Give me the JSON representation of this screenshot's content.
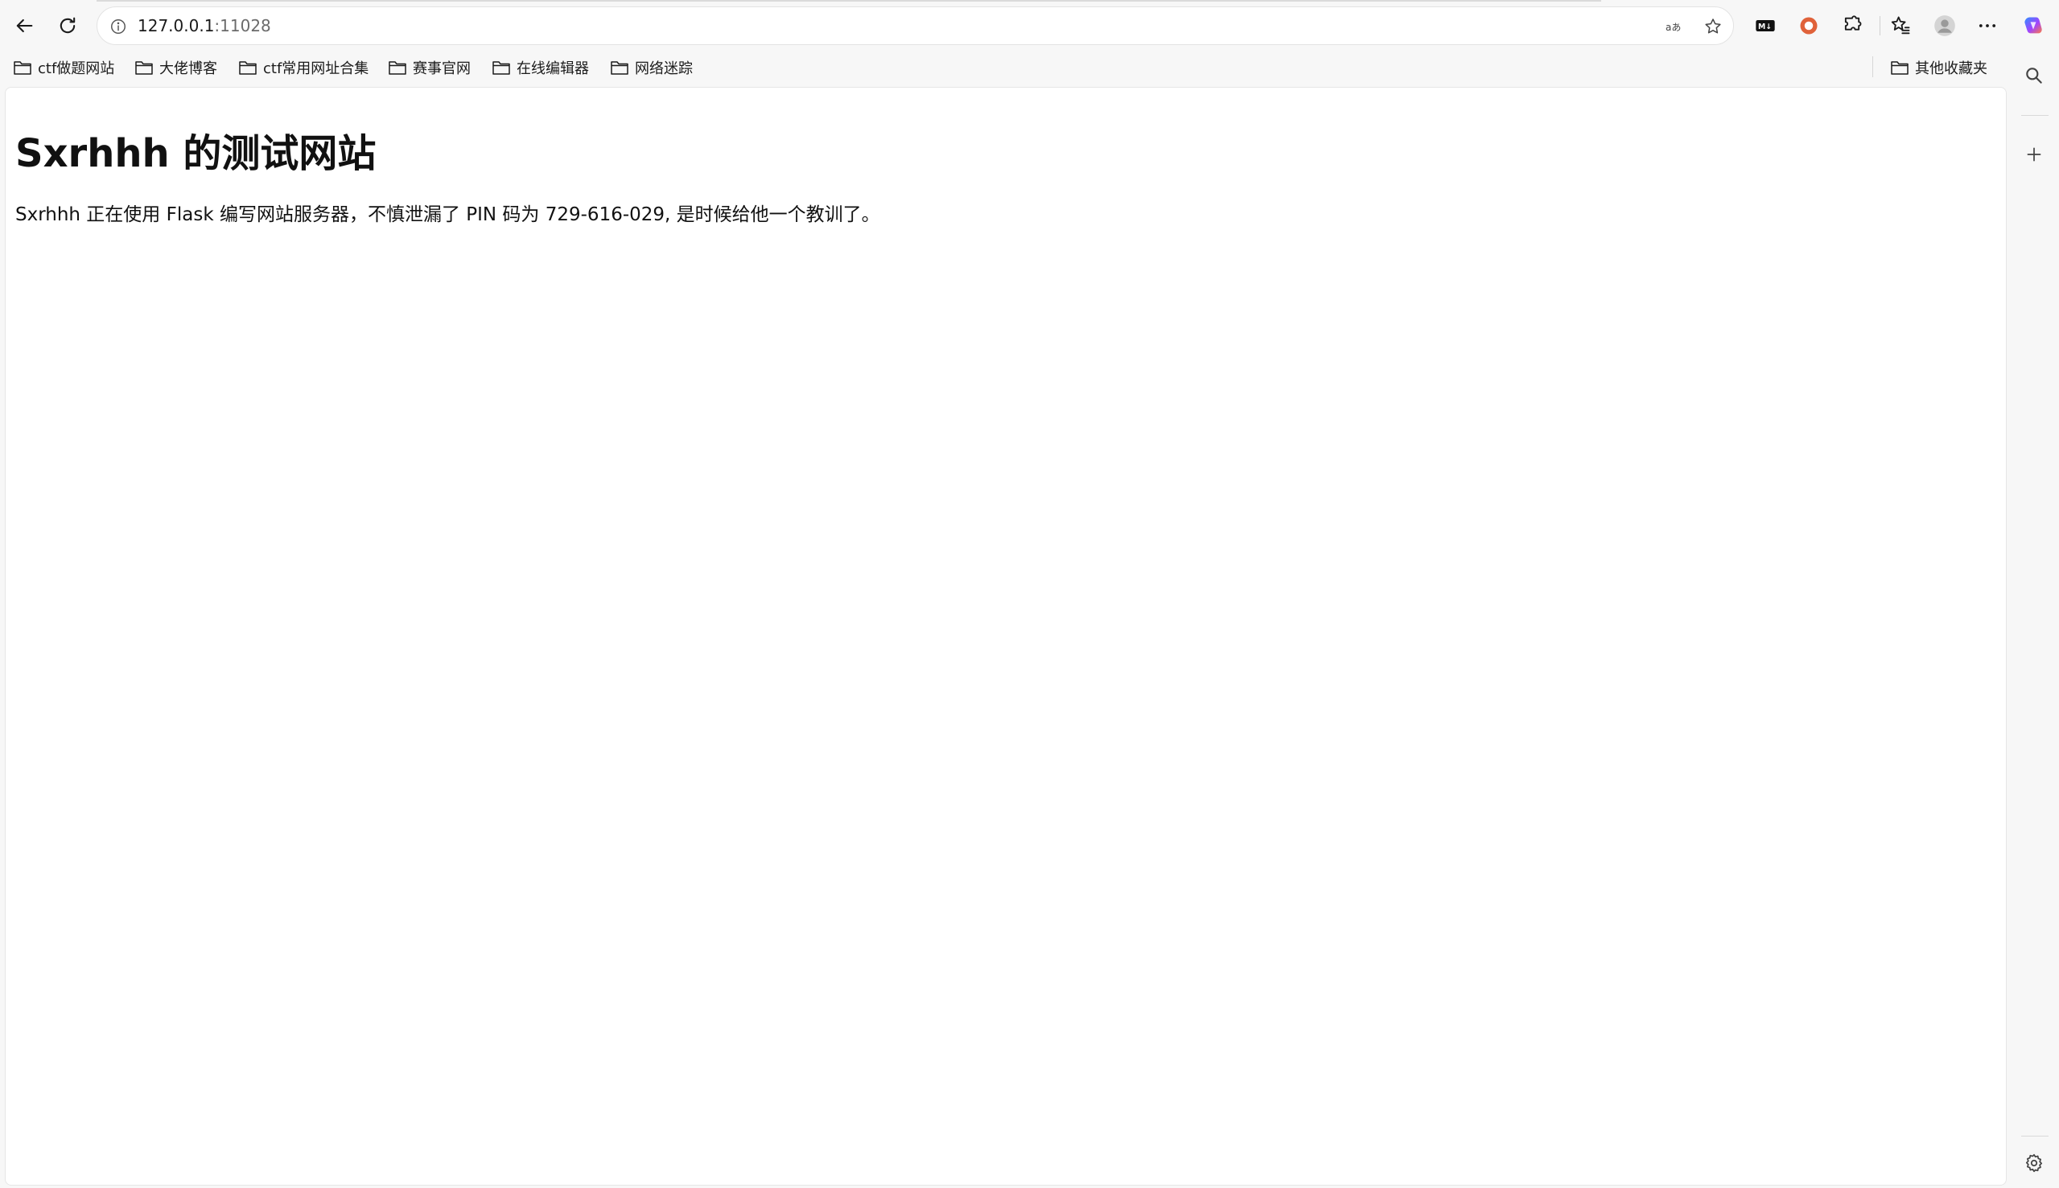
{
  "browser": {
    "address": {
      "host": "127.0.0.1",
      "port": ":11028"
    },
    "toolbar_icons": [
      "back-arrow-icon",
      "reload-icon",
      "site-info-icon",
      "read-aloud-icon",
      "favorite-star-icon",
      "markdown-extension-icon",
      "record-extension-icon",
      "extensions-puzzle-icon",
      "favorites-icon",
      "profile-avatar-icon",
      "more-menu-icon",
      "copilot-icon"
    ],
    "bookmarks": [
      {
        "label": "ctf做题网站"
      },
      {
        "label": "大佬博客"
      },
      {
        "label": "ctf常用网址合集"
      },
      {
        "label": "赛事官网"
      },
      {
        "label": "在线编辑器"
      },
      {
        "label": "网络迷踪"
      }
    ],
    "other_bookmarks": "其他收藏夹",
    "sidebar_icons": [
      "search-icon",
      "add-icon",
      "settings-gear-icon"
    ]
  },
  "page": {
    "heading": "Sxrhhh 的测试网站",
    "paragraph": "Sxrhhh 正在使用 Flask 编写网站服务器，不慎泄漏了 PIN 码为 729-616-029, 是时候给他一个教训了。"
  },
  "colors": {
    "chrome_bg": "#f7f7f7",
    "page_bg": "#ffffff",
    "record_icon": "#e0623a",
    "copilot_gradient": [
      "#2f8fff",
      "#a044ff",
      "#ff7a45"
    ]
  }
}
